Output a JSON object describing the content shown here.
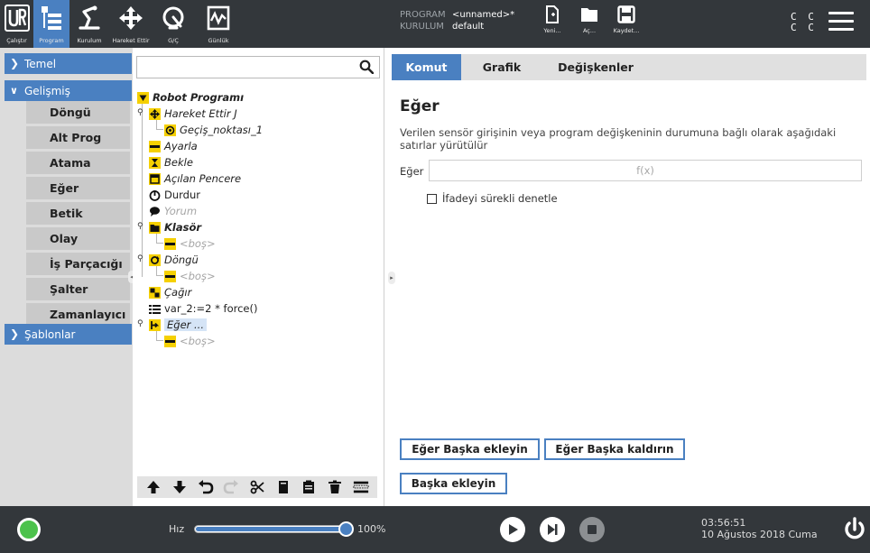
{
  "topbar": {
    "nav": [
      {
        "id": "calistir",
        "label": "Çalıştır",
        "icon": "run-icon"
      },
      {
        "id": "program",
        "label": "Program",
        "icon": "program-icon",
        "active": true
      },
      {
        "id": "kurulum",
        "label": "Kurulum",
        "icon": "installation-icon"
      },
      {
        "id": "hareket",
        "label": "Hareket Ettir",
        "icon": "move-icon"
      },
      {
        "id": "gc",
        "label": "G/Ç",
        "icon": "io-icon"
      },
      {
        "id": "gunluk",
        "label": "Günlük",
        "icon": "log-icon"
      }
    ],
    "program_key": "PROGRAM",
    "program_value": "<unnamed>*",
    "installation_key": "KURULUM",
    "installation_value": "default",
    "file_buttons": [
      {
        "label": "Yeni...",
        "icon": "new-file-icon"
      },
      {
        "label": "Aç...",
        "icon": "open-folder-icon"
      },
      {
        "label": "Kaydet...",
        "icon": "save-icon"
      }
    ],
    "cc_line1": "C C",
    "cc_line2": "C C",
    "accent_color": "#4a80c1",
    "bar_color": "#33373b"
  },
  "sidebar": {
    "categories": [
      {
        "label": "Temel",
        "expanded": false
      },
      {
        "label": "Gelişmiş",
        "expanded": true
      },
      {
        "label": "Şablonlar",
        "expanded": false
      }
    ],
    "advanced_items": [
      {
        "label": "Döngü"
      },
      {
        "label": "Alt Prog"
      },
      {
        "label": "Atama"
      },
      {
        "label": "Eğer"
      },
      {
        "label": "Betik"
      },
      {
        "label": "Olay"
      },
      {
        "label": "İş Parçacığı"
      },
      {
        "label": "Şalter"
      },
      {
        "label": "Zamanlayıcı"
      }
    ]
  },
  "tree": {
    "search_value": "",
    "nodes": [
      {
        "text": "Robot Programı",
        "icon": "triangle-down-icon"
      },
      {
        "text": "Hareket Ettir J",
        "icon": "move-icon"
      },
      {
        "text": "Geçiş_noktası_1",
        "icon": "waypoint-icon"
      },
      {
        "text": "Ayarla",
        "icon": "set-icon"
      },
      {
        "text": "Bekle",
        "icon": "hourglass-icon"
      },
      {
        "text": "Açılan Pencere",
        "icon": "popup-icon"
      },
      {
        "text": "Durdur",
        "icon": "halt-icon"
      },
      {
        "text": "Yorum",
        "icon": "comment-icon"
      },
      {
        "text": "Klasör",
        "icon": "folder-icon"
      },
      {
        "text": "<boş>",
        "icon": "empty-icon"
      },
      {
        "text": "Döngü",
        "icon": "loop-icon"
      },
      {
        "text": "<boş>",
        "icon": "empty-icon"
      },
      {
        "text": "Çağır",
        "icon": "call-icon"
      },
      {
        "text": "var_2:=2 * force()",
        "icon": "assign-icon"
      },
      {
        "text": "Eğer ...",
        "icon": "if-icon"
      },
      {
        "text": "<boş>",
        "icon": "empty-icon"
      }
    ]
  },
  "tabs": [
    {
      "label": "Komut",
      "active": true
    },
    {
      "label": "Grafik"
    },
    {
      "label": "Değişkenler"
    }
  ],
  "panel": {
    "title": "Eğer",
    "description": "Verilen sensör girişinin veya program değişkeninin durumuna bağlı olarak aşağıdaki satırlar yürütülür",
    "expr_label": "Eğer",
    "expr_placeholder": "f(x)",
    "checkbox_label": "İfadeyi sürekli denetle",
    "checkbox_checked": false,
    "btn_add_elseif": "Eğer Başka ekleyin",
    "btn_remove_elseif": "Eğer Başka kaldırın",
    "btn_add_else": "Başka ekleyin"
  },
  "bottombar": {
    "speed_label": "Hız",
    "speed_value": "100%",
    "speed_fraction": 1.0,
    "time": "03:56:51",
    "date": "10 Ağustos 2018 Cuma",
    "status_color": "#4cc24c"
  }
}
